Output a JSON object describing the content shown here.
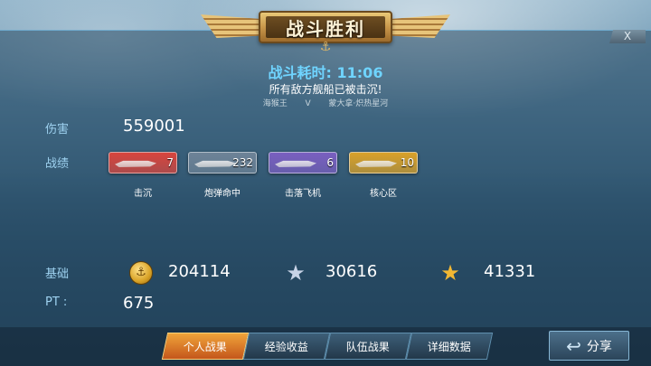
{
  "header": {
    "title": "战斗胜利",
    "close_label": "X"
  },
  "battle": {
    "time_label": "战斗耗时:",
    "time_value": "11:06",
    "result_text": "所有敌方舰船已被击沉!",
    "player_a": "海猴王",
    "vs": "V",
    "player_b": "蒙大拿·炽热星河"
  },
  "stats": {
    "damage_label": "伤害",
    "damage_value": "559001",
    "record_label": "战绩",
    "medals": [
      {
        "count": "7",
        "label": "击沉",
        "color": "#d8453d"
      },
      {
        "count": "232",
        "label": "炮弹命中",
        "color": "#6e8397"
      },
      {
        "count": "6",
        "label": "击落飞机",
        "color": "#7a5fc0"
      },
      {
        "count": "10",
        "label": "核心区",
        "color": "#d9a129"
      }
    ]
  },
  "rewards": {
    "base_label": "基础",
    "coins_value": "204114",
    "silver_star_value": "30616",
    "gold_star_value": "41331",
    "pt_label": "PT :",
    "pt_value": "675"
  },
  "icons": {
    "coin": "coin-icon",
    "silver_star": "silver-star-icon",
    "gold_star": "gold-star-icon",
    "share": "share-arrow-icon"
  },
  "tabs": [
    {
      "label": "个人战果",
      "active": true
    },
    {
      "label": "经验收益",
      "active": false
    },
    {
      "label": "队伍战果",
      "active": false
    },
    {
      "label": "详细数据",
      "active": false
    }
  ],
  "share_label": "分享",
  "colors": {
    "accent_cyan": "#6fd4ff",
    "tab_active": "#e0812a",
    "label_blue": "#9ed2f0"
  }
}
